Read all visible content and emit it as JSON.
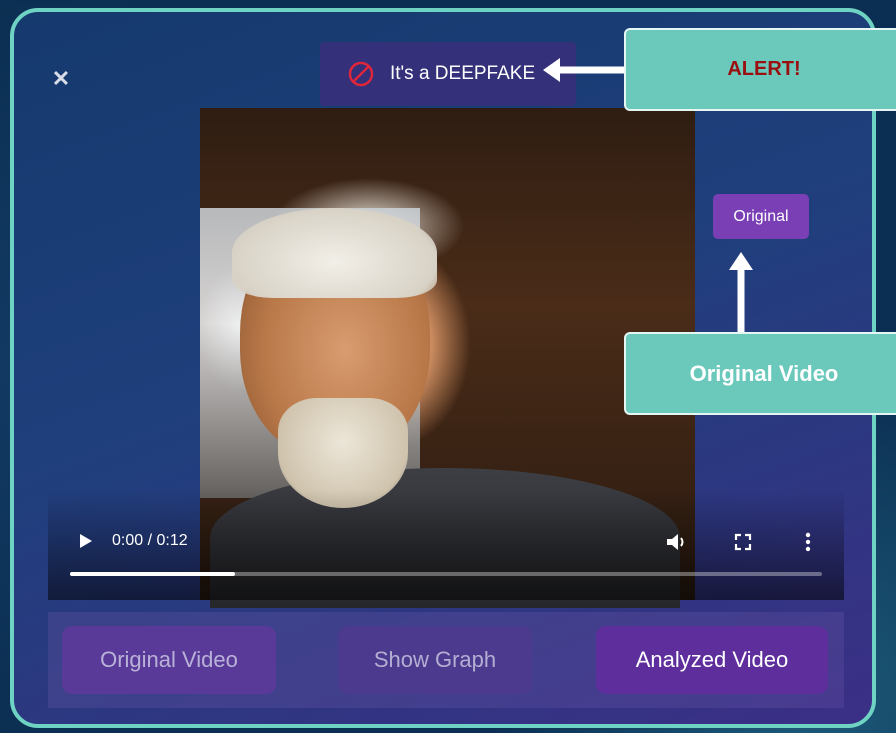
{
  "modal": {
    "verdict_text": "It's a DEEPFAKE",
    "close_icon": "close-icon",
    "verdict_icon": "prohibited-icon"
  },
  "video": {
    "current_time": "0:00",
    "duration": "0:12",
    "time_display": "0:00 / 0:12",
    "progress_fraction": 0.22,
    "icons": [
      "play-icon",
      "volume-icon",
      "fullscreen-icon",
      "more-vertical-icon"
    ]
  },
  "original_chip": "Original",
  "footer": {
    "original_video": "Original Video",
    "show_graph": "Show Graph",
    "analyzed_video": "Analyzed Video"
  },
  "annotations": {
    "alert": "ALERT!",
    "original_video": "Original Video"
  },
  "colors": {
    "border": "#6fd3c4",
    "callout": "#6ac9bb",
    "alert_text": "#9a1010",
    "verdict_icon": "#e0263a",
    "chip": "#7a3fb5"
  }
}
